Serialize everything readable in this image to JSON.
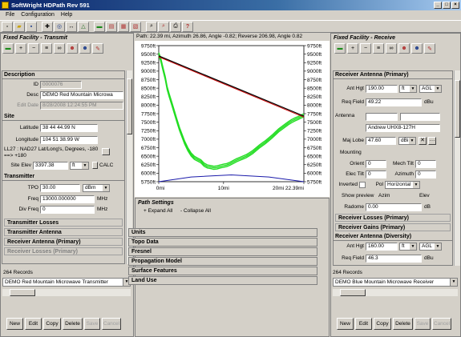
{
  "window": {
    "title": "SoftWright HDPath Rev 591"
  },
  "menu": [
    "File",
    "Configuration",
    "Help"
  ],
  "path_info": "Path: 22.39 mi, Azimuth 26.86, Angle -0.82; Reverse 206.98, Angle 0.82",
  "left_pane": {
    "header": "Fixed Facility - Transmit",
    "description": {
      "title": "Description",
      "id_label": "ID",
      "id_value": "0000076",
      "desc_label": "Desc",
      "desc_value": "DEMO Red Mountain Microwa",
      "edit_label": "Edit Date",
      "edit_value": "8/28/2008 12:24:55 PM"
    },
    "site": {
      "title": "Site",
      "lat_label": "Latitude",
      "lat_value": "38 44 44.99 N",
      "lon_label": "Longitude",
      "lon_value": "104 51 38.99 W",
      "datum_text": "LL27 : NAD27 Lat/Long's, Degrees, -180 ==> +180",
      "elev_label": "Site Elev",
      "elev_value": "3397.38",
      "elev_unit": "ft",
      "calc_label": "CALC"
    },
    "transmitter": {
      "title": "Transmitter",
      "tpo_label": "TPO",
      "tpo_value": "30.00",
      "tpo_unit": "dBm",
      "freq_label": "Freq",
      "freq_value": "13000.000000",
      "freq_unit": "MHz",
      "divfreq_label": "Div Freq",
      "divfreq_value": "0",
      "divfreq_unit": "MHz"
    },
    "groups": [
      "Transmitter Losses",
      "Transmitter Antenna",
      "Receiver Antenna (Primary)",
      "Receiver Losses (Primary)"
    ],
    "records": "264 Records",
    "selector": "DEMO Red Mountain Microwave Transmitter",
    "buttons": [
      "New",
      "Edit",
      "Copy",
      "Delete",
      "Save",
      "Cancel"
    ]
  },
  "right_pane": {
    "header": "Fixed Facility - Receive",
    "antenna": {
      "title": "Receiver Antenna (Primary)",
      "hgt_label": "Ant Hgt",
      "hgt_value": "190.00",
      "hgt_unit": "ft",
      "hgt_ref": "AGL",
      "reqfield_label": "Req Field",
      "reqfield_value": "49.22",
      "reqfield_unit": "dBu",
      "antenna_label": "Antenna",
      "antenna_value": "Andrew UHX8-127H",
      "majlobe_label": "Maj Lobe",
      "majlobe_value": "47.60",
      "majlobe_unit": "dBi",
      "mounting_label": "Mounting",
      "orient_label": "Orient",
      "orient_value": "0",
      "mechtilt_label": "Mech Tilt",
      "mechtilt_value": "0",
      "electilt_label": "Elec Tilt",
      "electilt_value": "0",
      "azimuth_label": "Azimuth",
      "azimuth_value": "0",
      "inverted_label": "Inverted",
      "pol_label": "Pol",
      "pol_value": "Horizontal",
      "showpreview_label": "Show preview",
      "azim_label": "Azim",
      "elev_label": "Elev",
      "radome_label": "Radome",
      "radome_value": "0.00",
      "radome_unit": "dB"
    },
    "groups": [
      "Receiver Losses (Primary)",
      "Receiver Gains (Primary)"
    ],
    "diversity": {
      "title": "Receiver Antenna (Diversity)",
      "hgt_label": "Ant Hgt",
      "hgt_value": "160.00",
      "hgt_unit": "ft",
      "hgt_ref": "AGL",
      "reqfield_label": "Req Field",
      "reqfield_value": "46.3",
      "reqfield_unit": "dBu"
    },
    "records": "264 Records",
    "selector": "DEMO Blue Mountain Microwave Receiver",
    "buttons": [
      "New",
      "Edit",
      "Copy",
      "Delete",
      "Save",
      "Cancel"
    ]
  },
  "path_settings": {
    "title": "Path Settings",
    "expand": "+ Expand All",
    "collapse": "- Collapse All",
    "items": [
      "Units",
      "Topo Data",
      "Fresnel",
      "Propagation Model",
      "Surface Features",
      "Land Use"
    ]
  },
  "chart_data": {
    "type": "line",
    "x_ticks": [
      "0mi",
      "10mi",
      "20mi 22.39mi"
    ],
    "y_ticks": [
      "9750ft",
      "9500ft",
      "9250ft",
      "9000ft",
      "8750ft",
      "8500ft",
      "8250ft",
      "8000ft",
      "7750ft",
      "7500ft",
      "7250ft",
      "7000ft",
      "6750ft",
      "6500ft",
      "6250ft",
      "6000ft",
      "5750ft"
    ],
    "xlim": [
      0,
      22.39
    ],
    "ylim": [
      5750,
      9750
    ],
    "colors": {
      "terrain": "#22dd22",
      "path": "#000000",
      "fresnel": "#cc0000",
      "curve": "#1a1aaa"
    },
    "path_line": [
      [
        0,
        9450
      ],
      [
        22.39,
        7680
      ]
    ],
    "fresnel_line": [
      [
        0,
        9420
      ],
      [
        22.39,
        7650
      ]
    ],
    "earth_curve": [
      [
        0,
        5750
      ],
      [
        5,
        5890
      ],
      [
        11.2,
        5950
      ],
      [
        17,
        5890
      ],
      [
        22.39,
        5750
      ]
    ],
    "terrain": [
      [
        0,
        9500
      ],
      [
        0.3,
        9350
      ],
      [
        0.6,
        9100
      ],
      [
        1,
        8800
      ],
      [
        1.3,
        8500
      ],
      [
        1.6,
        8300
      ],
      [
        2,
        8050
      ],
      [
        2.4,
        7800
      ],
      [
        2.8,
        7550
      ],
      [
        3.2,
        7300
      ],
      [
        3.6,
        7100
      ],
      [
        4,
        6900
      ],
      [
        4.5,
        6700
      ],
      [
        5,
        6550
      ],
      [
        5.5,
        6450
      ],
      [
        6,
        6400
      ],
      [
        6.5,
        6350
      ],
      [
        7,
        6250
      ],
      [
        7.5,
        6200
      ],
      [
        8,
        6180
      ],
      [
        8.5,
        6160
      ],
      [
        9,
        6170
      ],
      [
        9.5,
        6200
      ],
      [
        10,
        6220
      ],
      [
        10.5,
        6240
      ],
      [
        11,
        6280
      ],
      [
        11.5,
        6330
      ],
      [
        12,
        6380
      ],
      [
        12.5,
        6420
      ],
      [
        13,
        6460
      ],
      [
        13.5,
        6500
      ],
      [
        14,
        6560
      ],
      [
        14.5,
        6620
      ],
      [
        15,
        6700
      ],
      [
        15.5,
        6780
      ],
      [
        16,
        6850
      ],
      [
        16.5,
        6920
      ],
      [
        17,
        7000
      ],
      [
        17.5,
        7080
      ],
      [
        18,
        7170
      ],
      [
        18.5,
        7260
      ],
      [
        19,
        7330
      ],
      [
        19.5,
        7400
      ],
      [
        20,
        7470
      ],
      [
        20.5,
        7530
      ],
      [
        21,
        7580
      ],
      [
        21.5,
        7620
      ],
      [
        22,
        7670
      ],
      [
        22.39,
        7700
      ]
    ]
  }
}
